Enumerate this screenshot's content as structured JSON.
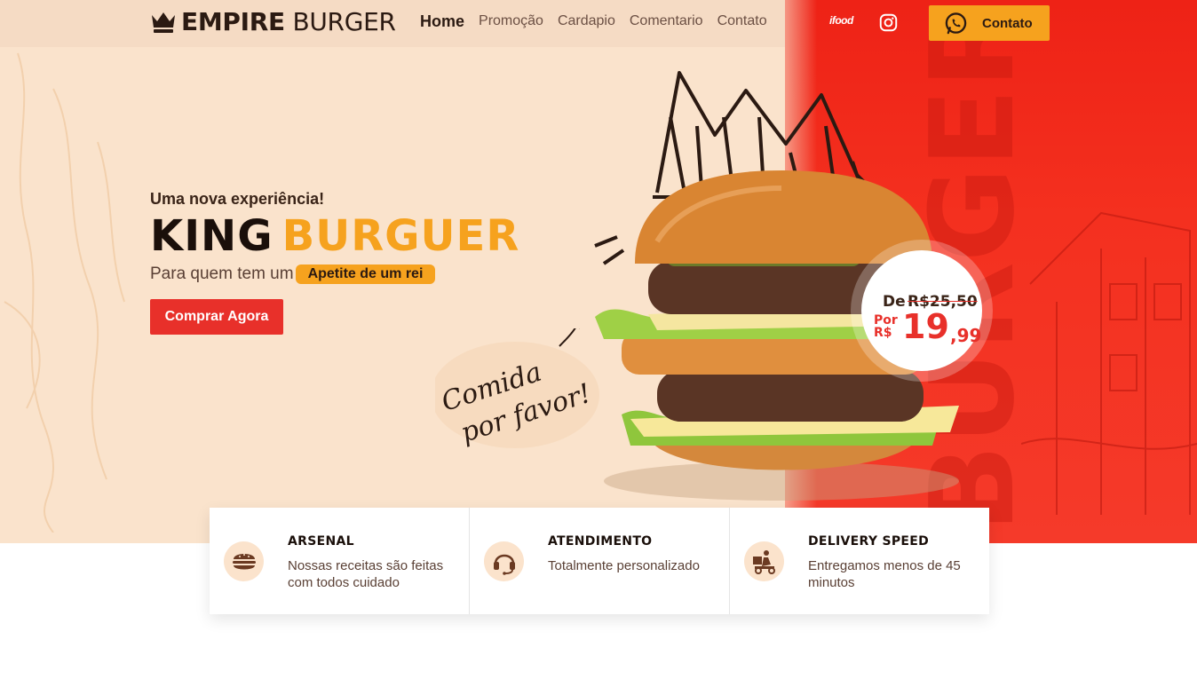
{
  "brand": {
    "bold": "EMPIRE",
    "light": "BURGER"
  },
  "nav": {
    "items": [
      {
        "label": "Home",
        "active": true
      },
      {
        "label": "Promoção"
      },
      {
        "label": "Cardapio"
      },
      {
        "label": "Comentario"
      },
      {
        "label": "Contato"
      }
    ],
    "ifood": "ifood",
    "contact_button": "Contato"
  },
  "hero": {
    "tagline": "Uma nova experiência!",
    "title_dark": "KING",
    "title_accent": "BURGUER",
    "subline": "Para quem tem um",
    "pill": "Apetite de um rei",
    "cta": "Comprar Agora",
    "handwriting_line1": "Comida",
    "handwriting_line2": "por favor!",
    "background_word": "BURGER"
  },
  "price": {
    "from_label": "De",
    "old_price": "R$25,50",
    "for_label_1": "Por",
    "for_label_2": "R$",
    "new_price": "19",
    "new_cents": ",99"
  },
  "features": [
    {
      "title": "ARSENAL",
      "text": "Nossas receitas são feitas com todos cuidado",
      "icon": "burger-icon"
    },
    {
      "title": "ATENDIMENTO",
      "text": "Totalmente personalizado",
      "icon": "headset-icon"
    },
    {
      "title": "DELIVERY SPEED",
      "text": "Entregamos menos de 45 minutos",
      "icon": "delivery-icon"
    }
  ],
  "colors": {
    "accent": "#f6a21e",
    "red": "#e8302a",
    "cream": "#fae3cc",
    "dark": "#2b1a12"
  }
}
